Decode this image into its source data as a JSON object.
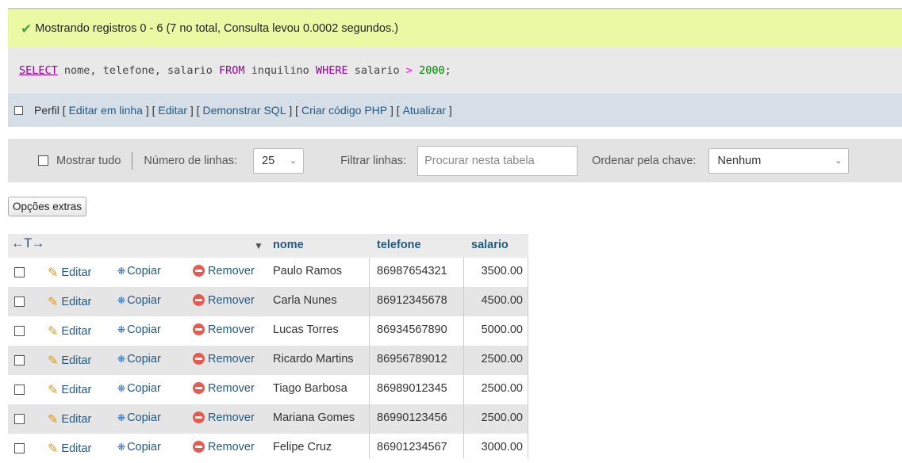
{
  "message": {
    "text": "Mostrando registros 0 - 6 (7 no total, Consulta levou 0.0002 segundos.)"
  },
  "query": {
    "select": "SELECT",
    "fields": "nome, telefone, salario",
    "from": "FROM",
    "table": "inquilino",
    "where": "WHERE",
    "column": "salario",
    "operator": ">",
    "value": "2000",
    "end": ";"
  },
  "profile": {
    "label": "Perfil",
    "links": [
      "Editar em linha",
      "Editar",
      "Demonstrar SQL",
      "Criar código PHP",
      "Atualizar"
    ]
  },
  "navigation": {
    "show_all": "Mostrar tudo",
    "rows_label": "Número de linhas:",
    "rows_value": "25",
    "filter_label": "Filtrar linhas:",
    "filter_placeholder": "Procurar nesta tabela",
    "sort_label": "Ordenar pela chave:",
    "sort_value": "Nenhum"
  },
  "extra_options": "Opções extras",
  "table": {
    "arrows": "←T→",
    "columns": [
      "nome",
      "telefone",
      "salario"
    ],
    "actions": {
      "edit": "Editar",
      "copy": "Copiar",
      "delete": "Remover"
    },
    "rows": [
      {
        "nome": "Paulo Ramos",
        "telefone": "86987654321",
        "salario": "3500.00"
      },
      {
        "nome": "Carla Nunes",
        "telefone": "86912345678",
        "salario": "4500.00"
      },
      {
        "nome": "Lucas Torres",
        "telefone": "86934567890",
        "salario": "5000.00"
      },
      {
        "nome": "Ricardo Martins",
        "telefone": "86956789012",
        "salario": "2500.00"
      },
      {
        "nome": "Tiago Barbosa",
        "telefone": "86989012345",
        "salario": "2500.00"
      },
      {
        "nome": "Mariana Gomes",
        "telefone": "86990123456",
        "salario": "2500.00"
      },
      {
        "nome": "Felipe Cruz",
        "telefone": "86901234567",
        "salario": "3000.00"
      }
    ]
  },
  "colors": {
    "success_bg": "#ebf8a4",
    "link": "#235a81",
    "keyword": "#990099",
    "number": "#008000"
  }
}
